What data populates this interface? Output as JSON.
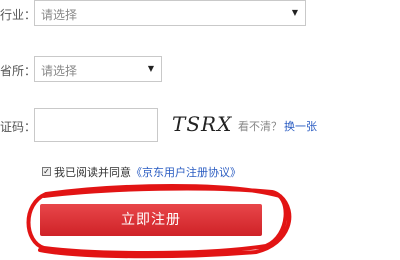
{
  "form": {
    "row1": {
      "label": "行业：",
      "value": "请选择"
    },
    "row2": {
      "label": "省所：",
      "value": "请选择"
    },
    "row3": {
      "label": "证码：",
      "captcha": "TSRX",
      "hint": "看不清？",
      "refresh": "换一张"
    }
  },
  "agreement": {
    "prefix": "我已阅读并同意",
    "protocol": "《京东用户注册协议》"
  },
  "submit_label": "立即注册",
  "colors": {
    "button": "#d9282e",
    "annotation": "#e00000",
    "link": "#2a5cc2"
  }
}
